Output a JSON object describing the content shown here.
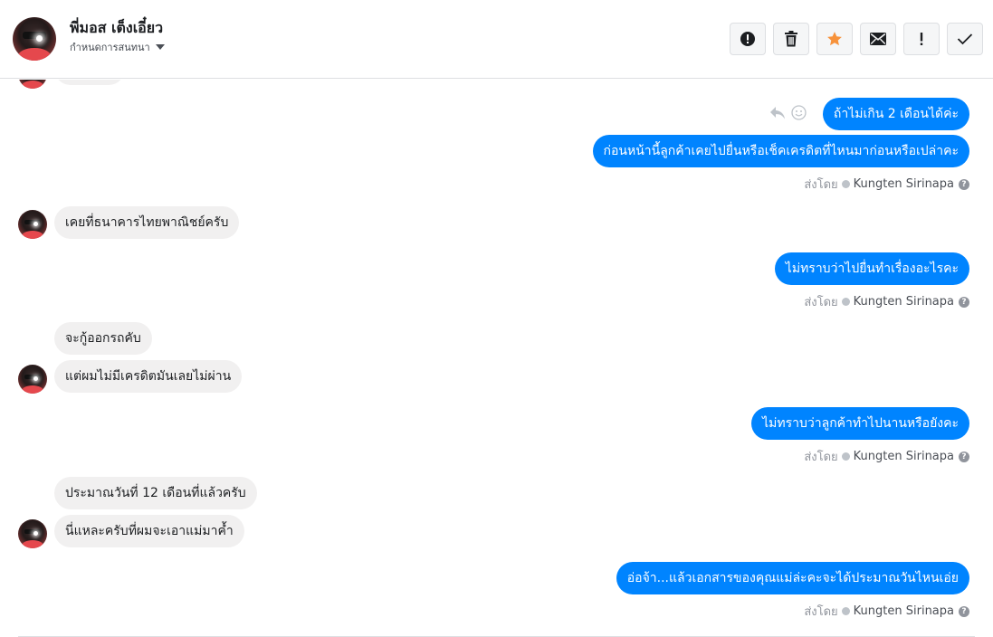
{
  "header": {
    "contact_name": "พี่มอส เต็งเอี๋ยว",
    "assign_label": "กำหนดการสนทนา"
  },
  "toolbar": {
    "buttons": [
      {
        "name": "report-spam-button",
        "icon": "exclamation-circle-icon"
      },
      {
        "name": "delete-button",
        "icon": "trash-icon"
      },
      {
        "name": "star-button",
        "icon": "star-icon",
        "color": "#f7923b"
      },
      {
        "name": "mark-unread-button",
        "icon": "envelope-icon"
      },
      {
        "name": "follow-up-button",
        "icon": "exclamation-icon"
      },
      {
        "name": "mark-done-button",
        "icon": "checkmark-icon"
      }
    ]
  },
  "colors": {
    "outgoing_bubble": "#0084ff",
    "incoming_bubble": "#f1f0f0"
  },
  "sent_by": {
    "prefix": "ส่งโดย",
    "agent": "Kungten Sirinapa",
    "help": "?"
  },
  "messages": [
    {
      "direction": "out",
      "text": "ถ้าไม่เกิน 2 เดือนได้ค่ะ"
    },
    {
      "direction": "out",
      "text": "ก่อนหน้านี้ลูกค้าเคยไปยื่นหรือเช็คเครดิตที่ไหนมาก่อนหรือเปล่าคะ"
    },
    {
      "direction": "in",
      "text": "เคยที่ธนาคารไทยพาณิชย์ครับ"
    },
    {
      "direction": "out",
      "text": "ไม่ทราบว่าไปยื่นทำเรื่องอะไรคะ"
    },
    {
      "direction": "in",
      "text": "จะกู้ออกรถคับ"
    },
    {
      "direction": "in",
      "text": "แต่ผมไม่มีเครดิตมันเลยไม่ผ่าน"
    },
    {
      "direction": "out",
      "text": "ไม่ทราบว่าลูกค้าทำไปนานหรือยังคะ"
    },
    {
      "direction": "in",
      "text": "ประมาณวันที่ 12 เดือนที่แล้วครับ"
    },
    {
      "direction": "in",
      "text": "นี่แหละครับที่ผมจะเอาแม่มาค้ำ"
    },
    {
      "direction": "out",
      "text": "อ่อจ้า...แล้วเอกสารของคุณแม่ล่ะคะจะได้ประมาณวันไหนเอ่ย"
    }
  ]
}
